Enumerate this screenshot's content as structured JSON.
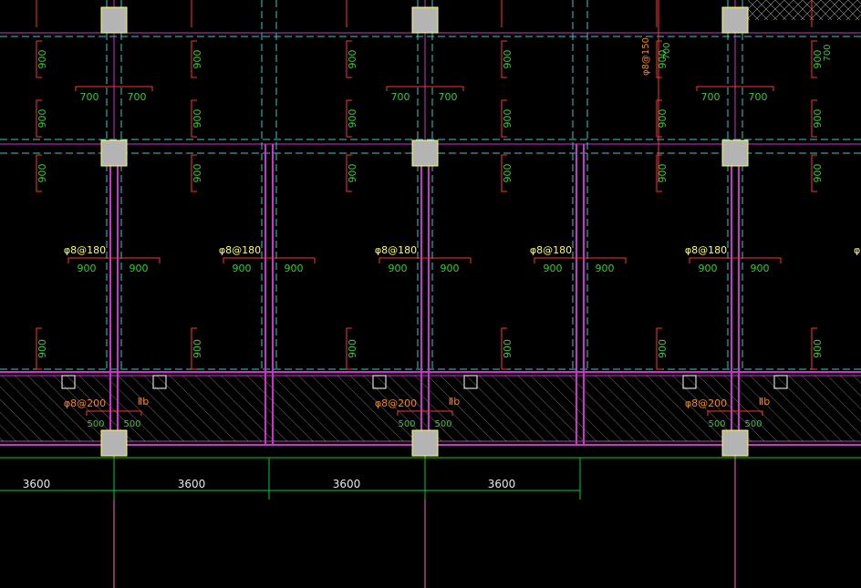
{
  "colors": {
    "background": "#000000",
    "axis": "#00cc33",
    "grid_dash": "#33cccc",
    "wall": "#cc33cc",
    "rebar": "#ff3333",
    "column_fill": "#b4b4b4",
    "column_edge": "#ffff66",
    "label_green": "#33cc33",
    "label_yellow": "#ffff66",
    "label_orange": "#ff8800",
    "hatch": "#ffffff",
    "axis_pink": "#ff66cc"
  },
  "labels": {
    "span_top": "700",
    "span_mid": "900",
    "span_bottom": "500",
    "rebar_vertical": "900",
    "rebar_side": "700",
    "rebar_mid": "φ8@180",
    "rebar_bottom": "φ8@200",
    "rebar_top_right": "φ8@150",
    "bottom_tag": "Ⅱb"
  },
  "dimensions": [
    "3600",
    "3600",
    "3600",
    "3600"
  ]
}
